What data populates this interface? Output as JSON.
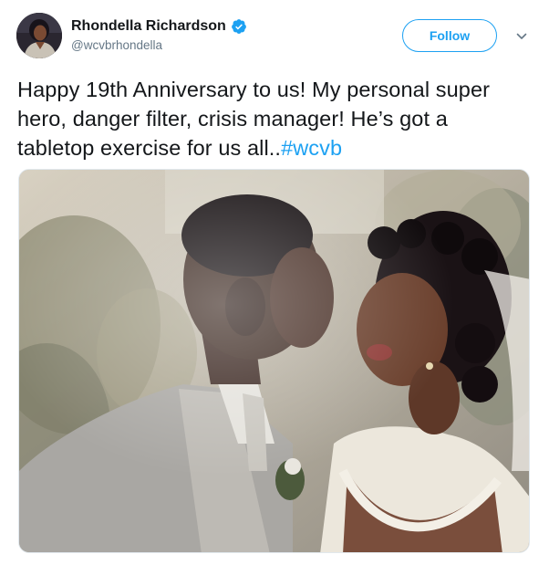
{
  "user": {
    "display_name": "Rhondella Richardson",
    "handle": "@wcvbrhondella",
    "verified": true,
    "avatar_icon": "profile-photo"
  },
  "actions": {
    "follow_label": "Follow",
    "menu_icon": "chevron-down-icon"
  },
  "tweet": {
    "text": "Happy 19th Anniversary to us! My personal super hero, danger filter, crisis manager! He’s got a tabletop exercise for us all..",
    "hashtag": "#wcvb"
  },
  "media": {
    "type": "photo",
    "subject": "wedding-kiss-photo"
  },
  "colors": {
    "accent": "#1da1f2",
    "text": "#14171a",
    "secondary_text": "#657786"
  }
}
